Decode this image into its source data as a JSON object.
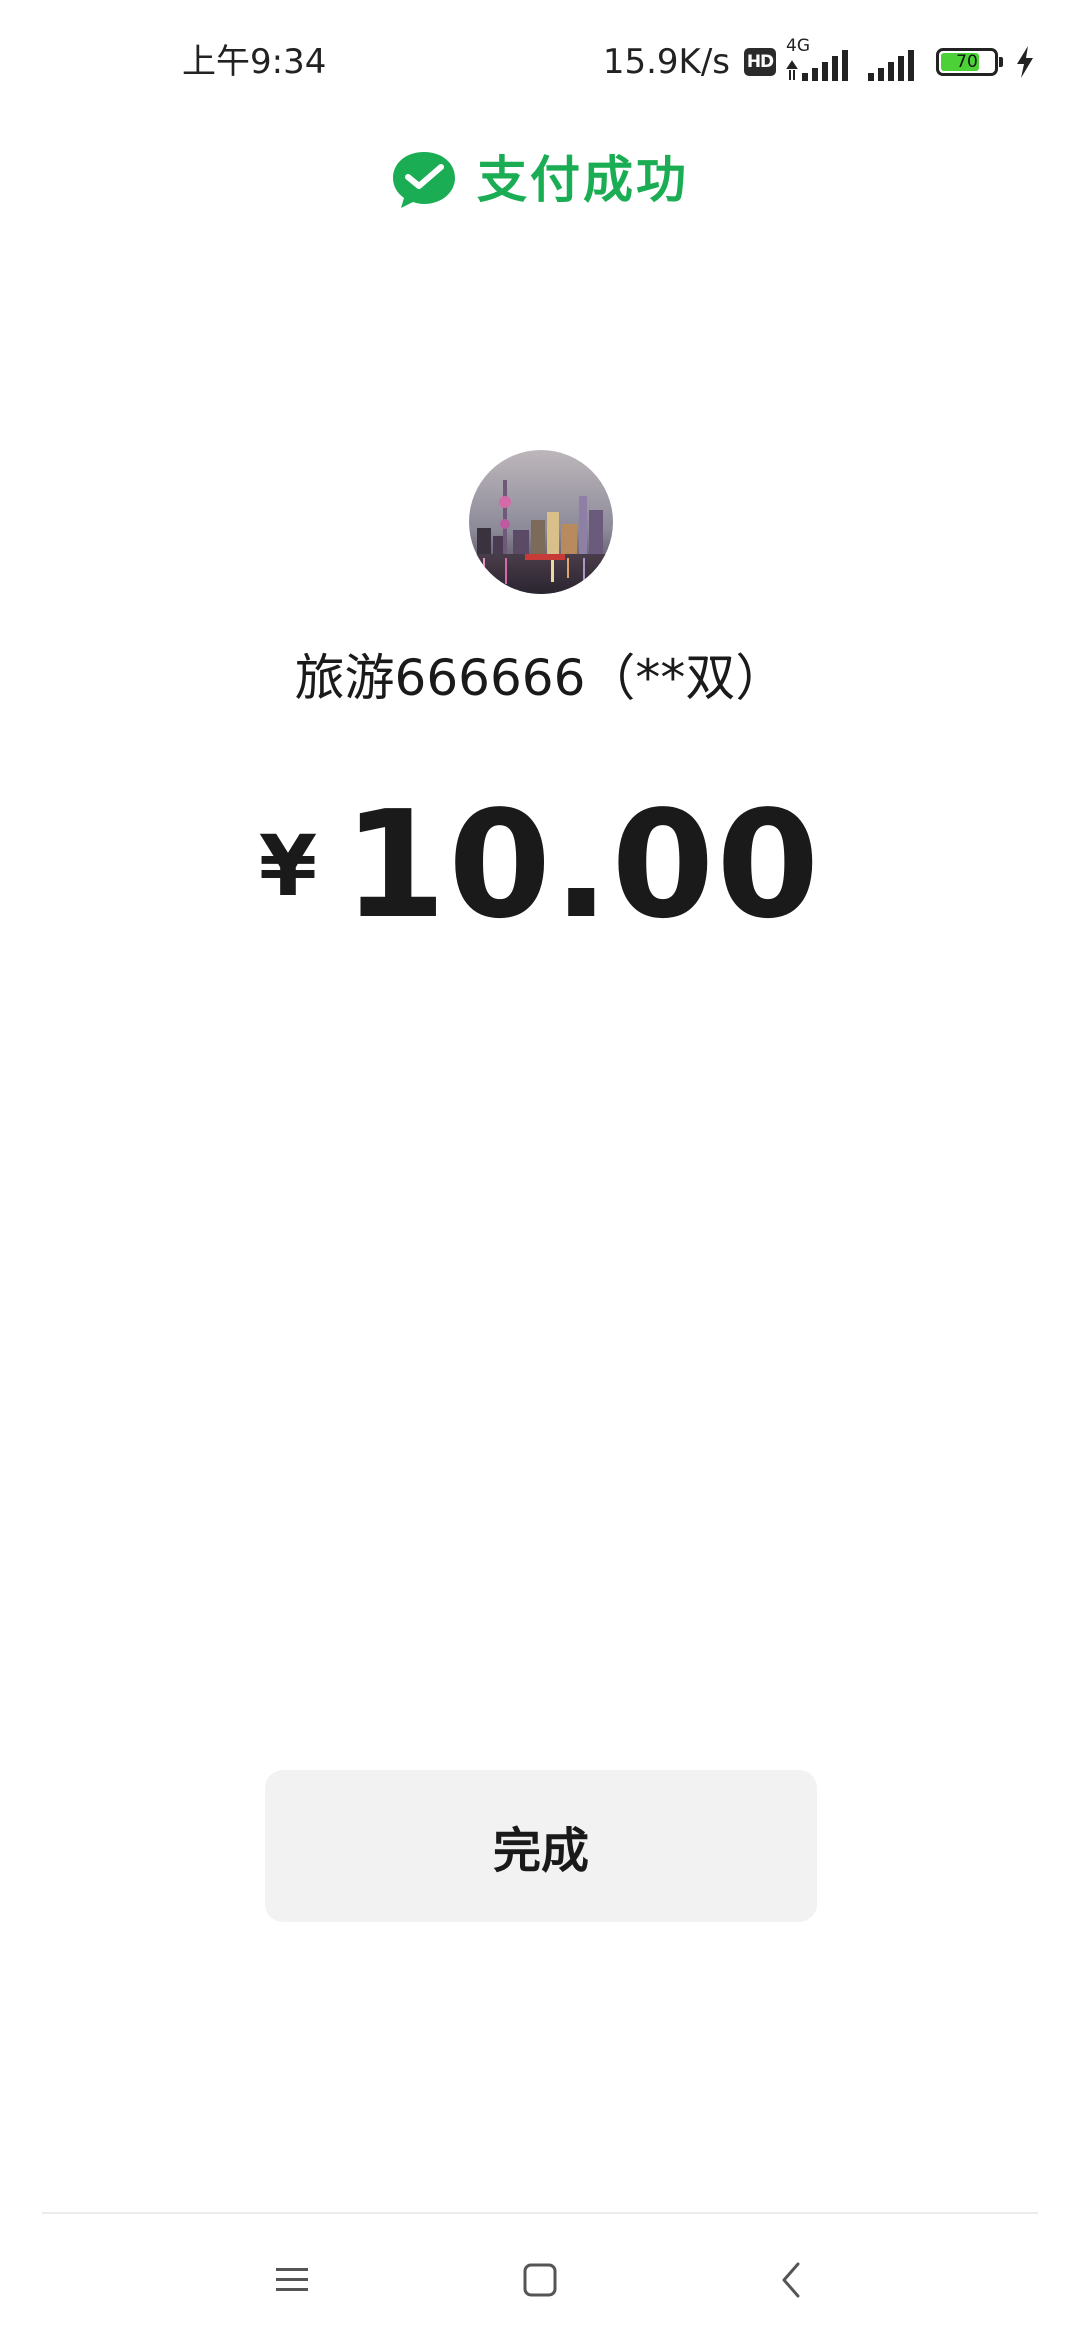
{
  "status_bar": {
    "time": "上午9:34",
    "net_speed": "15.9K/s",
    "hd_badge": "HD",
    "network_type": "4G",
    "battery_level": "70",
    "icons": [
      "hd-icon",
      "signal-icon",
      "signal-icon",
      "battery-icon",
      "charging-icon"
    ]
  },
  "header": {
    "title": "支付成功",
    "icon": "wechat-pay-icon",
    "accent_color": "#1aad53"
  },
  "payee": {
    "name": "旅游666666（**双）",
    "avatar": "city-skyline-night-image"
  },
  "amount": {
    "currency": "¥",
    "value": "10.00"
  },
  "actions": {
    "done_label": "完成"
  },
  "nav_bar": {
    "icons": [
      "menu-icon",
      "home-icon",
      "back-icon"
    ]
  }
}
